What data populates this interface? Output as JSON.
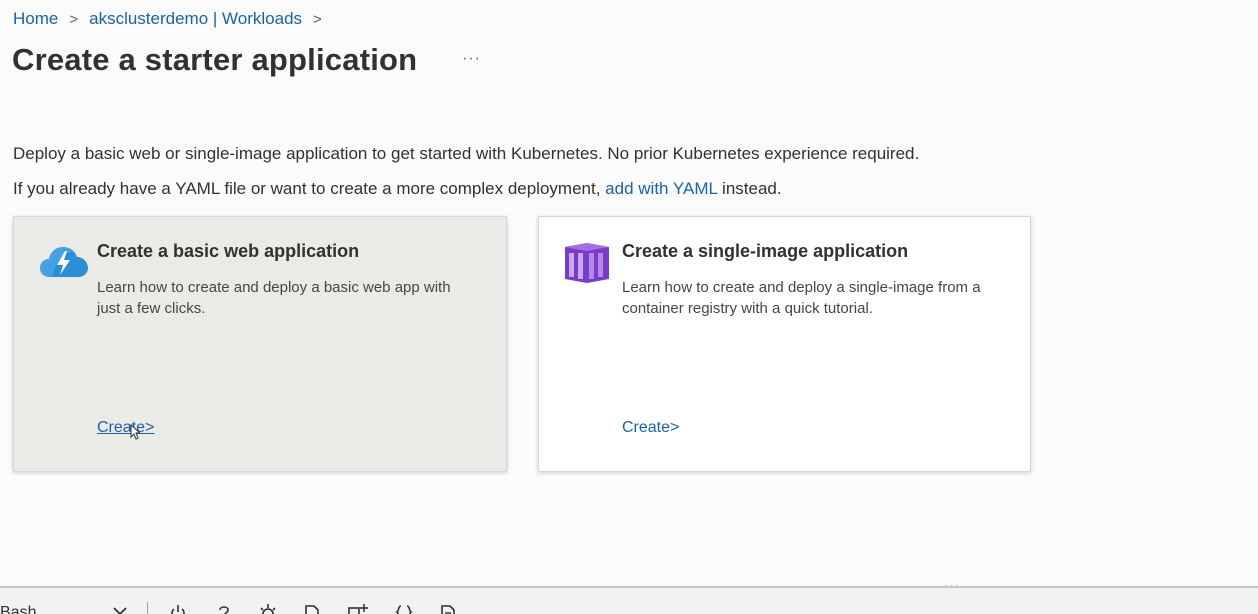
{
  "breadcrumb": {
    "home": "Home",
    "cluster": "aksclusterdemo | Workloads",
    "separator": ">"
  },
  "page": {
    "title": "Create a starter application",
    "more": "···"
  },
  "description": {
    "line1": "Deploy a basic web or single-image application to get started with Kubernetes. No prior Kubernetes experience required.",
    "line2_prefix": "If you already have a YAML file or want to create a more complex deployment,",
    "line2_link": "add with YAML",
    "line2_suffix": "instead."
  },
  "cards": {
    "web": {
      "icon": "cloud-bolt-icon",
      "title": "Create a basic web application",
      "description": "Learn how to create and deploy a basic web app with just a few clicks.",
      "link": "Create>"
    },
    "image": {
      "icon": "container-icon",
      "title": "Create a single-image application",
      "description": "Learn how to create and deploy a single-image from a container registry with a quick tutorial.",
      "link": "Create>"
    }
  },
  "bottom_panel": {
    "handle": "···",
    "shell": "Bash"
  },
  "colors": {
    "link": "#1a63a8",
    "selected_card": "#eaeae7",
    "cloud_icon": "#2a8ed8",
    "container_icon": "#7a3cc8"
  }
}
